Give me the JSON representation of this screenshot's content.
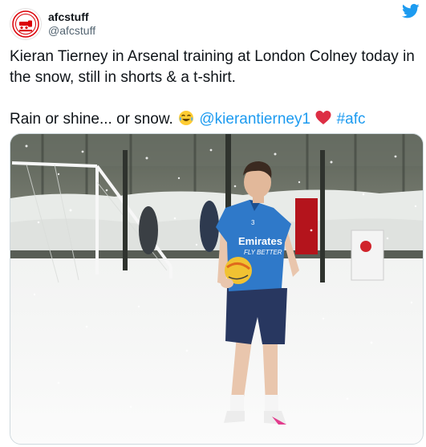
{
  "tweet": {
    "author": {
      "display_name": "afcstuff",
      "handle": "@afcstuff",
      "avatar_icon": "arsenal-crest-icon"
    },
    "platform_icon": "twitter-bird-icon",
    "text": {
      "line1": "Kieran Tierney in Arsenal training at London Colney today in the snow, still in shorts & a t-shirt.",
      "line2_prefix": "Rain or shine... or snow. ",
      "emoji_1": "face-with-tears-of-joy-emoji",
      "mention": "@kierantierney1",
      "emoji_2": "red-heart-emoji",
      "hashtag": "#afc"
    },
    "photo": {
      "shirt_sponsor_line1": "Emirates",
      "shirt_sponsor_line2": "FLY BETTER",
      "shirt_number": "3"
    },
    "colors": {
      "link": "#1d9bf0",
      "twitter_blue": "#1d9bf0",
      "arsenal_red": "#db0007",
      "text": "#0f1419",
      "secondary": "#536471"
    }
  }
}
